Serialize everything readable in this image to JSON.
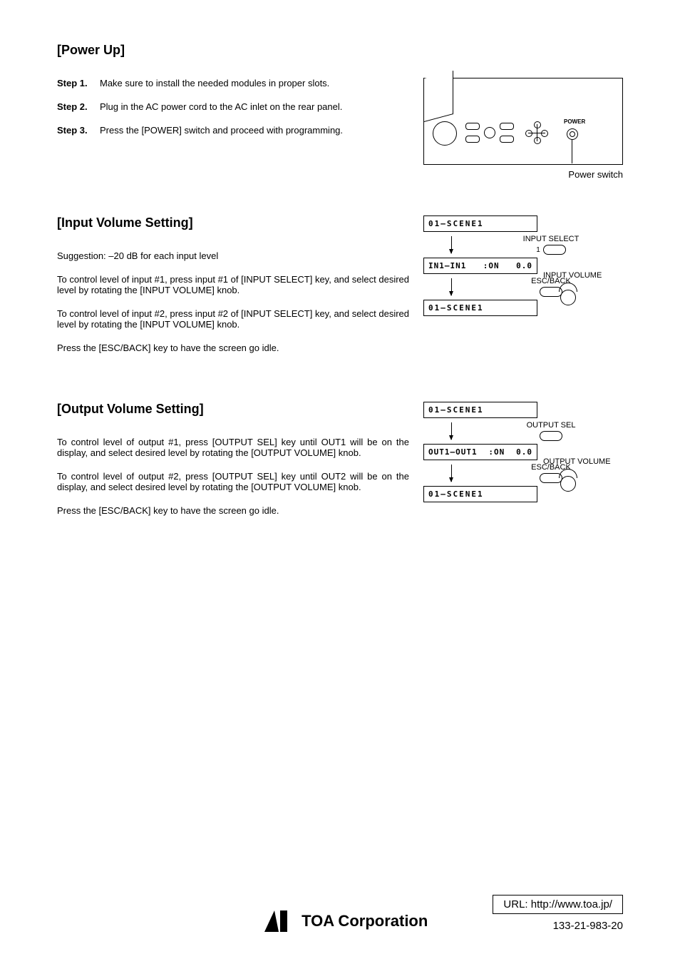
{
  "sections": {
    "power_up": {
      "heading": "[Power Up]",
      "steps": [
        {
          "label": "Step 1.",
          "text": "Make sure to install the needed modules in proper slots."
        },
        {
          "label": "Step 2.",
          "text": "Plug in the AC power cord to the AC inlet on the rear panel."
        },
        {
          "label": "Step 3.",
          "text": "Press the [POWER] switch and proceed with programming."
        }
      ],
      "figure": {
        "power_label": "POWER",
        "caption": "Power switch"
      }
    },
    "input_volume": {
      "heading": "[Input Volume Setting]",
      "suggestion": "Suggestion: –20 dB for each input level",
      "paras": [
        "To control level of input #1, press input #1 of [INPUT SELECT] key, and select desired level by rotating the [INPUT VOLUME] knob.",
        "To control level of input #2, press input #2 of [INPUT SELECT] key, and select desired level by rotating the [INPUT VOLUME] knob.",
        "Press the [ESC/BACK] key to have the screen go idle."
      ],
      "flow": {
        "lcd_top": "01–SCENE1",
        "ctl_top": "INPUT SELECT",
        "ctl_top_num": "1",
        "lcd_mid_left": "IN1–IN1",
        "lcd_mid_on": ":ON",
        "lcd_mid_val": "0.0",
        "side_label": "INPUT VOLUME",
        "ctl_bot": "ESC/BACK",
        "lcd_bot": "01–SCENE1"
      }
    },
    "output_volume": {
      "heading": "[Output Volume Setting]",
      "paras": [
        "To control level of output #1, press [OUTPUT SEL] key until OUT1 will be on the display, and select desired level by rotating the [OUTPUT VOLUME] knob.",
        "To control level of output #2, press [OUTPUT SEL] key until OUT2 will be on the display, and select desired level by rotating the [OUTPUT VOLUME] knob.",
        "Press the [ESC/BACK] key to have the screen go idle."
      ],
      "flow": {
        "lcd_top": "01–SCENE1",
        "ctl_top": "OUTPUT SEL",
        "lcd_mid_left": "OUT1–OUT1",
        "lcd_mid_on": ":ON",
        "lcd_mid_val": "0.0",
        "side_label": "OUTPUT VOLUME",
        "ctl_bot": "ESC/BACK",
        "lcd_bot": "01–SCENE1"
      }
    }
  },
  "footer": {
    "logo_text": "TOA Corporation",
    "url_label": "URL:  http://www.toa.jp/",
    "doc_number": "133-21-983-20"
  }
}
